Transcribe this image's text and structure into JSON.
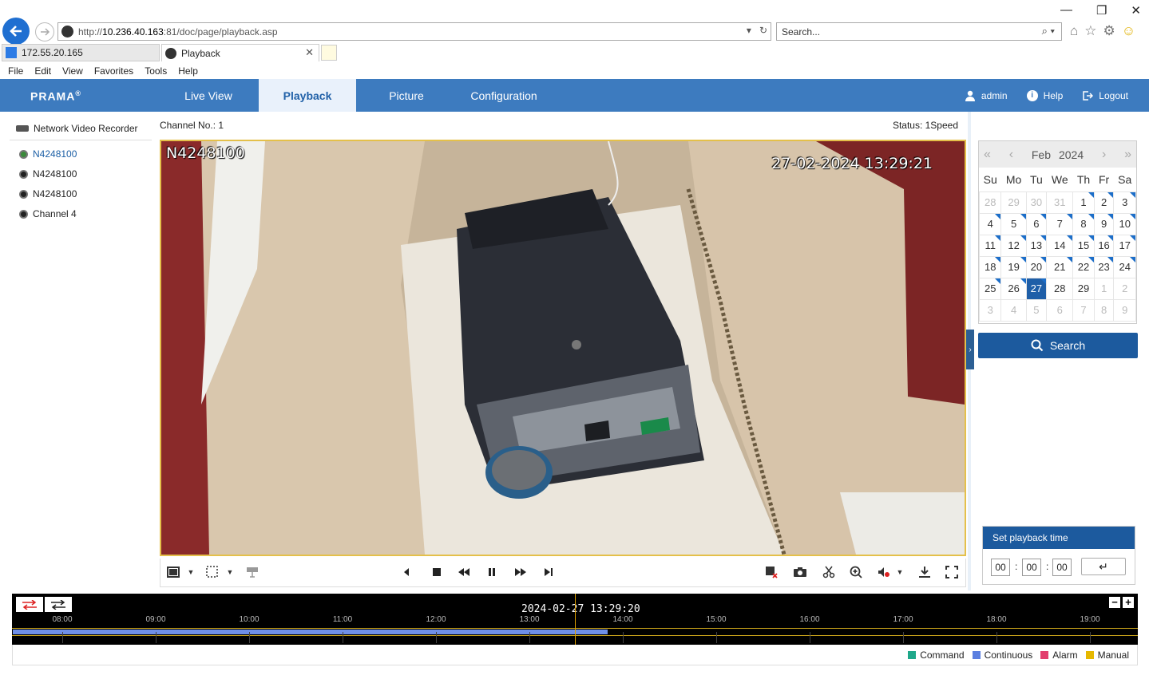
{
  "browser": {
    "url_prefix": "http://",
    "url_host": "10.236.40.163",
    "url_rest": ":81/doc/page/playback.asp",
    "search_placeholder": "Search...",
    "tabs": [
      {
        "label": "172.55.20.165"
      },
      {
        "label": "Playback"
      }
    ],
    "menu": [
      "File",
      "Edit",
      "View",
      "Favorites",
      "Tools",
      "Help"
    ]
  },
  "app": {
    "logo": "PRAMA",
    "nav": [
      {
        "label": "Live View"
      },
      {
        "label": "Playback",
        "active": true
      },
      {
        "label": "Picture"
      },
      {
        "label": "Configuration"
      }
    ],
    "user": "admin",
    "help": "Help",
    "logout": "Logout"
  },
  "tree": {
    "root": "Network Video Recorder",
    "channels": [
      "N4248100",
      "N4248100",
      "N4248100",
      "Channel 4"
    ]
  },
  "player": {
    "channel_no": "Channel No.: 1",
    "status": "Status: 1Speed",
    "osd_name": "N4248100",
    "osd_time": "27-02-2024 13:29:21"
  },
  "calendar": {
    "month": "Feb",
    "year": "2024",
    "weekdays": [
      "Su",
      "Mo",
      "Tu",
      "We",
      "Th",
      "Fr",
      "Sa"
    ],
    "weeks": [
      [
        "28",
        "29",
        "30",
        "31",
        "1",
        "2",
        "3"
      ],
      [
        "4",
        "5",
        "6",
        "7",
        "8",
        "9",
        "10"
      ],
      [
        "11",
        "12",
        "13",
        "14",
        "15",
        "16",
        "17"
      ],
      [
        "18",
        "19",
        "20",
        "21",
        "22",
        "23",
        "24"
      ],
      [
        "25",
        "26",
        "27",
        "28",
        "29",
        "1",
        "2"
      ],
      [
        "3",
        "4",
        "5",
        "6",
        "7",
        "8",
        "9"
      ]
    ],
    "selected_day": "27",
    "search_label": "Search"
  },
  "playback_time": {
    "title": "Set playback time",
    "hh": "00",
    "mm": "00",
    "ss": "00"
  },
  "timeline": {
    "current": "2024-02-27 13:29:20",
    "hours": [
      "08:00",
      "09:00",
      "10:00",
      "11:00",
      "12:00",
      "13:00",
      "14:00",
      "15:00",
      "16:00",
      "17:00",
      "18:00",
      "19:00"
    ],
    "legend": [
      {
        "label": "Command",
        "color": "#1fa88a"
      },
      {
        "label": "Continuous",
        "color": "#5b7fe0"
      },
      {
        "label": "Alarm",
        "color": "#e23e6e"
      },
      {
        "label": "Manual",
        "color": "#e6b800"
      }
    ]
  }
}
